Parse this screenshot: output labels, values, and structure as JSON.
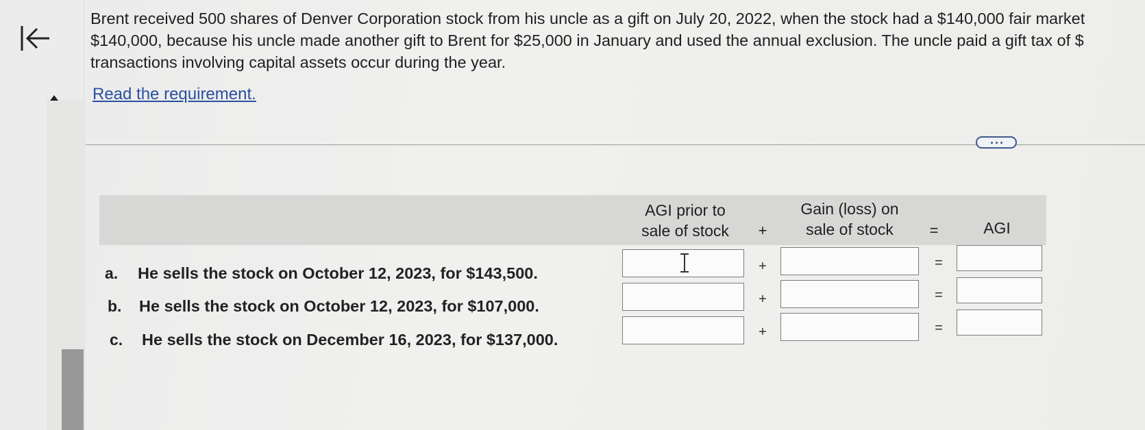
{
  "question": {
    "line1": "Brent received 500 shares of Denver Corporation stock from his uncle as a gift on July 20, 2022, when the stock had a $140,000 fair market",
    "line2": "$140,000, because his uncle made another gift to Brent for $25,000 in January and used the annual exclusion. The uncle paid a gift tax of $",
    "line3": "transactions involving capital assets occur during the year."
  },
  "requirement_link": "Read the requirement.",
  "table": {
    "headers": {
      "agi_prior": [
        "AGI prior to",
        "sale of stock"
      ],
      "plus": "+",
      "gain": [
        "Gain (loss) on",
        "sale of stock"
      ],
      "equals": "=",
      "agi": "AGI"
    },
    "rows": [
      {
        "letter": "a.",
        "label": "He sells the stock on October 12, 2023, for $143,500.",
        "plus": "+",
        "equals": "=",
        "agi_prior": "",
        "gain": "",
        "agi": ""
      },
      {
        "letter": "b.",
        "label": "He sells the stock on October 12, 2023, for $107,000.",
        "plus": "+",
        "equals": "=",
        "agi_prior": "",
        "gain": "",
        "agi": ""
      },
      {
        "letter": "c.",
        "label": "He sells the stock on December 16, 2023, for $137,000.",
        "plus": "+",
        "equals": "=",
        "agi_prior": "",
        "gain": "",
        "agi": ""
      }
    ]
  },
  "icons": {
    "back": "back-to-start-icon",
    "collapse": "triangle-up-icon",
    "more": "more-options-icon"
  },
  "colors": {
    "link": "#2a4f9e",
    "header_band": "#d7d7d6",
    "more_button": "#3d5a8a"
  }
}
